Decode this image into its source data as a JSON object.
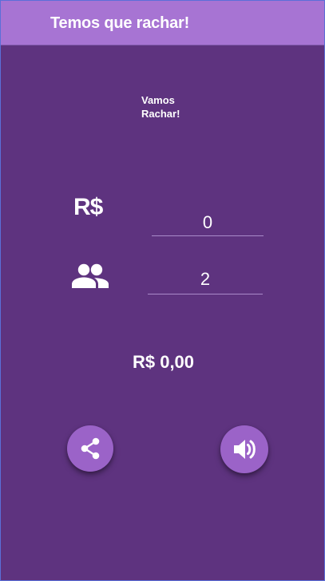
{
  "app_bar": {
    "title": "Temos que rachar!"
  },
  "subtitle": {
    "line1": "Vamos",
    "line2": "Rachar!"
  },
  "amount": {
    "currency_label": "R$",
    "value": "0"
  },
  "people": {
    "icon": "people-icon",
    "value": "2"
  },
  "result": {
    "total": "R$ 0,00"
  },
  "actions": {
    "share_icon": "share-icon",
    "sound_icon": "volume-icon"
  },
  "colors": {
    "background": "#5e337f",
    "app_bar": "#a774d3",
    "fab": "#9b63c8",
    "text": "#ffffff"
  }
}
